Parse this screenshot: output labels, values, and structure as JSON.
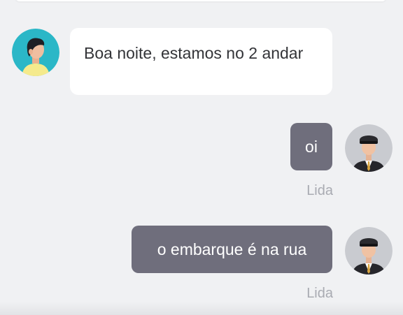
{
  "colors": {
    "background": "#f0f1f3",
    "incoming_bubble": "#ffffff",
    "outgoing_bubble": "#6f6e7c",
    "read_status": "#a9abb2",
    "user_avatar_bg": "#2bb7c7",
    "driver_avatar_bg": "#c9cbd0"
  },
  "messages": [
    {
      "direction": "incoming",
      "text": "Boa noite, estamos no 2 andar",
      "avatar_icon": "user-avatar-icon"
    },
    {
      "direction": "outgoing",
      "text": "oi",
      "status": "Lida",
      "avatar_icon": "driver-avatar-icon"
    },
    {
      "direction": "outgoing",
      "text": "o embarque é na rua",
      "status": "Lida",
      "avatar_icon": "driver-avatar-icon"
    }
  ]
}
